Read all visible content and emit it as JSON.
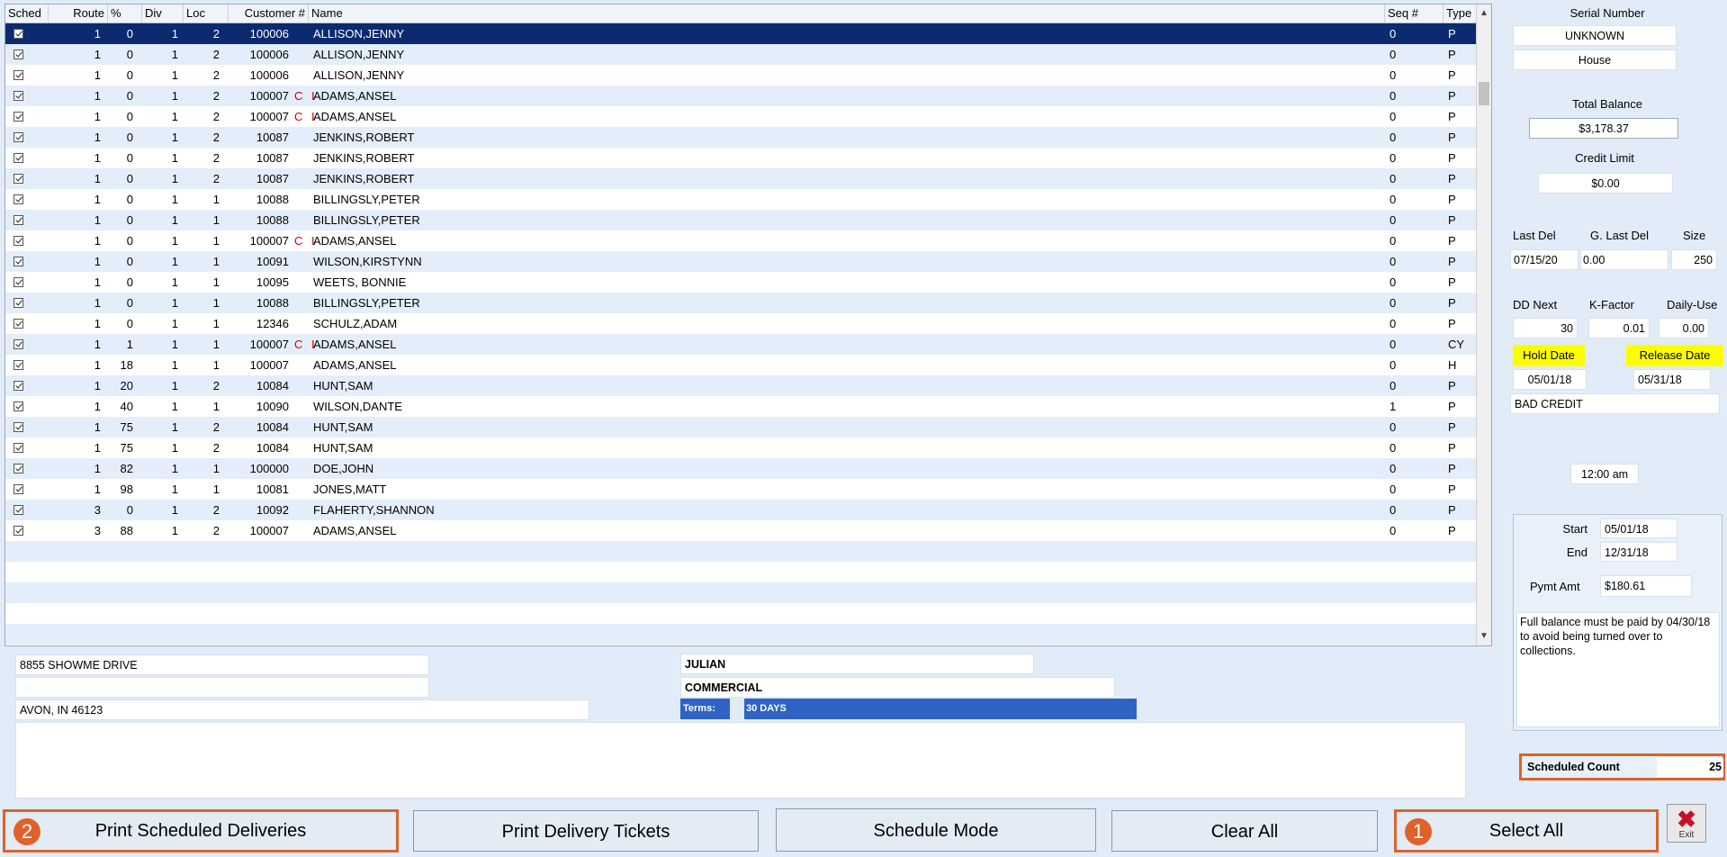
{
  "columns": {
    "sched": "Sched",
    "route": "Route",
    "pct": "%",
    "div": "Div",
    "loc": "Loc",
    "customer": "Customer #",
    "name": "Name",
    "seq": "Seq #",
    "type": "Type"
  },
  "rows": [
    {
      "route": "1",
      "pct": "0",
      "div": "1",
      "loc": "2",
      "cust": "100006",
      "ci": "",
      "name": "ALLISON,JENNY",
      "seq": "0",
      "type": "P"
    },
    {
      "route": "1",
      "pct": "0",
      "div": "1",
      "loc": "2",
      "cust": "100006",
      "ci": "",
      "name": "ALLISON,JENNY",
      "seq": "0",
      "type": "P"
    },
    {
      "route": "1",
      "pct": "0",
      "div": "1",
      "loc": "2",
      "cust": "100006",
      "ci": "",
      "name": "ALLISON,JENNY",
      "seq": "0",
      "type": "P"
    },
    {
      "route": "1",
      "pct": "0",
      "div": "1",
      "loc": "2",
      "cust": "100007",
      "ci": "C I",
      "name": "ADAMS,ANSEL",
      "seq": "0",
      "type": "P"
    },
    {
      "route": "1",
      "pct": "0",
      "div": "1",
      "loc": "2",
      "cust": "100007",
      "ci": "C I",
      "name": "ADAMS,ANSEL",
      "seq": "0",
      "type": "P"
    },
    {
      "route": "1",
      "pct": "0",
      "div": "1",
      "loc": "2",
      "cust": "10087",
      "ci": "",
      "name": "JENKINS,ROBERT",
      "seq": "0",
      "type": "P"
    },
    {
      "route": "1",
      "pct": "0",
      "div": "1",
      "loc": "2",
      "cust": "10087",
      "ci": "",
      "name": "JENKINS,ROBERT",
      "seq": "0",
      "type": "P"
    },
    {
      "route": "1",
      "pct": "0",
      "div": "1",
      "loc": "2",
      "cust": "10087",
      "ci": "",
      "name": "JENKINS,ROBERT",
      "seq": "0",
      "type": "P"
    },
    {
      "route": "1",
      "pct": "0",
      "div": "1",
      "loc": "1",
      "cust": "10088",
      "ci": "",
      "name": "BILLINGSLY,PETER",
      "seq": "0",
      "type": "P"
    },
    {
      "route": "1",
      "pct": "0",
      "div": "1",
      "loc": "1",
      "cust": "10088",
      "ci": "",
      "name": "BILLINGSLY,PETER",
      "seq": "0",
      "type": "P"
    },
    {
      "route": "1",
      "pct": "0",
      "div": "1",
      "loc": "1",
      "cust": "100007",
      "ci": "C I",
      "name": "ADAMS,ANSEL",
      "seq": "0",
      "type": "P"
    },
    {
      "route": "1",
      "pct": "0",
      "div": "1",
      "loc": "1",
      "cust": "10091",
      "ci": "",
      "name": "WILSON,KIRSTYNN",
      "seq": "0",
      "type": "P"
    },
    {
      "route": "1",
      "pct": "0",
      "div": "1",
      "loc": "1",
      "cust": "10095",
      "ci": "",
      "name": "WEETS, BONNIE",
      "seq": "0",
      "type": "P"
    },
    {
      "route": "1",
      "pct": "0",
      "div": "1",
      "loc": "1",
      "cust": "10088",
      "ci": "",
      "name": "BILLINGSLY,PETER",
      "seq": "0",
      "type": "P"
    },
    {
      "route": "1",
      "pct": "0",
      "div": "1",
      "loc": "1",
      "cust": "12346",
      "ci": "",
      "name": "SCHULZ,ADAM",
      "seq": "0",
      "type": "P"
    },
    {
      "route": "1",
      "pct": "1",
      "div": "1",
      "loc": "1",
      "cust": "100007",
      "ci": "C I",
      "name": "ADAMS,ANSEL",
      "seq": "0",
      "type": "CY"
    },
    {
      "route": "1",
      "pct": "18",
      "div": "1",
      "loc": "1",
      "cust": "100007",
      "ci": "",
      "name": "ADAMS,ANSEL",
      "seq": "0",
      "type": "H"
    },
    {
      "route": "1",
      "pct": "20",
      "div": "1",
      "loc": "2",
      "cust": "10084",
      "ci": "",
      "name": "HUNT,SAM",
      "seq": "0",
      "type": "P"
    },
    {
      "route": "1",
      "pct": "40",
      "div": "1",
      "loc": "1",
      "cust": "10090",
      "ci": "",
      "name": "WILSON,DANTE",
      "seq": "1",
      "type": "P"
    },
    {
      "route": "1",
      "pct": "75",
      "div": "1",
      "loc": "2",
      "cust": "10084",
      "ci": "",
      "name": "HUNT,SAM",
      "seq": "0",
      "type": "P"
    },
    {
      "route": "1",
      "pct": "75",
      "div": "1",
      "loc": "2",
      "cust": "10084",
      "ci": "",
      "name": "HUNT,SAM",
      "seq": "0",
      "type": "P"
    },
    {
      "route": "1",
      "pct": "82",
      "div": "1",
      "loc": "1",
      "cust": "100000",
      "ci": "",
      "name": "DOE,JOHN",
      "seq": "0",
      "type": "P"
    },
    {
      "route": "1",
      "pct": "98",
      "div": "1",
      "loc": "1",
      "cust": "10081",
      "ci": "",
      "name": "JONES,MATT",
      "seq": "0",
      "type": "P"
    },
    {
      "route": "3",
      "pct": "0",
      "div": "1",
      "loc": "2",
      "cust": "10092",
      "ci": "",
      "name": "FLAHERTY,SHANNON",
      "seq": "0",
      "type": "P"
    },
    {
      "route": "3",
      "pct": "88",
      "div": "1",
      "loc": "2",
      "cust": "100007",
      "ci": "",
      "name": "ADAMS,ANSEL",
      "seq": "0",
      "type": "P"
    }
  ],
  "address": {
    "line1": "8855 SHOWME DRIVE",
    "line2": "",
    "city": "AVON, IN 46123",
    "county": "JULIAN",
    "category": "COMMERCIAL",
    "terms_label": "Terms:",
    "terms_value": "30 DAYS"
  },
  "side": {
    "serial_label": "Serial Number",
    "serial_value": "UNKNOWN",
    "location_value": "House",
    "total_balance_label": "Total Balance",
    "total_balance_value": "$3,178.37",
    "credit_limit_label": "Credit Limit",
    "credit_limit_value": "$0.00",
    "last_del_label": "Last Del",
    "g_last_del_label": "G. Last Del",
    "size_label": "Size",
    "last_del_value": "07/15/20",
    "g_last_del_value": "0.00",
    "size_value": "250",
    "dd_next_label": "DD Next",
    "k_factor_label": "K-Factor",
    "daily_use_label": "Daily-Use",
    "dd_next_value": "30",
    "k_factor_value": "0.01",
    "daily_use_value": "0.00",
    "hold_date_label": "Hold Date",
    "release_date_label": "Release Date",
    "hold_date_value": "05/01/18",
    "release_date_value": "05/31/18",
    "hold_reason": "BAD CREDIT",
    "time_value": "12:00 am",
    "start_label": "Start",
    "start_value": "05/01/18",
    "end_label": "End",
    "end_value": "12/31/18",
    "pymt_amt_label": "Pymt Amt",
    "pymt_amt_value": "$180.61",
    "note": "Full balance must be paid by 04/30/18 to avoid being turned over to collections.",
    "scheduled_count_label": "Scheduled Count",
    "scheduled_count_value": "25"
  },
  "buttons": {
    "print_scheduled": "Print Scheduled Deliveries",
    "print_scheduled_badge": "2",
    "print_tickets": "Print Delivery Tickets",
    "schedule_mode": "Schedule Mode",
    "clear_all": "Clear All",
    "select_all": "Select All",
    "select_all_badge": "1",
    "exit": "Exit"
  },
  "colors": {
    "selected_row": "#0b2a6f",
    "alt_row": "#e4eefa",
    "highlight_border": "#d9642a",
    "hold_yellow": "#fdfd00",
    "terms_blue": "#2e63c4"
  }
}
